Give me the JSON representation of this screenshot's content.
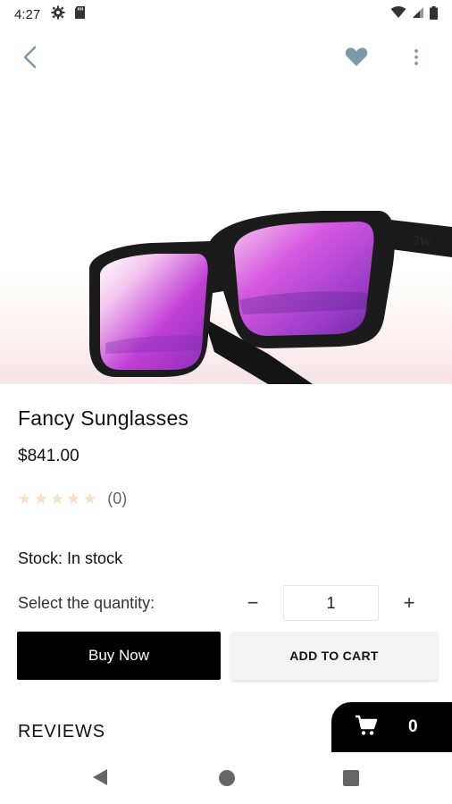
{
  "status_bar": {
    "time": "4:27",
    "icons": [
      "gear-icon",
      "sd-card-icon",
      "wifi-icon",
      "signal-icon",
      "battery-icon"
    ]
  },
  "app_bar": {
    "back_icon": "chevron-left-icon",
    "favorite_icon": "heart-icon",
    "more_icon": "more-vertical-icon",
    "icon_color": "#7a9aa8"
  },
  "product": {
    "image": "purple-mirrored-sunglasses",
    "title": "Fancy Sunglasses",
    "price": "$841.00",
    "rating": {
      "stars": 5,
      "filled": 0,
      "count": "(0)"
    },
    "stock_label": "Stock:",
    "stock_value": "In stock",
    "quantity_label": "Select the quantity:",
    "quantity_value": "1",
    "minus": "−",
    "plus": "+"
  },
  "actions": {
    "buy_now": "Buy Now",
    "add_to_cart": "ADD TO CART"
  },
  "reviews": {
    "heading": "REVIEWS"
  },
  "cart": {
    "icon": "cart-icon",
    "count": "0"
  },
  "nav_bar": {
    "back": "triangle-back-icon",
    "home": "circle-home-icon",
    "recent": "square-recent-icon"
  },
  "colors": {
    "primary": "#000000",
    "secondary_button": "#f3f3f4",
    "star_empty": "#f7dfc0"
  }
}
